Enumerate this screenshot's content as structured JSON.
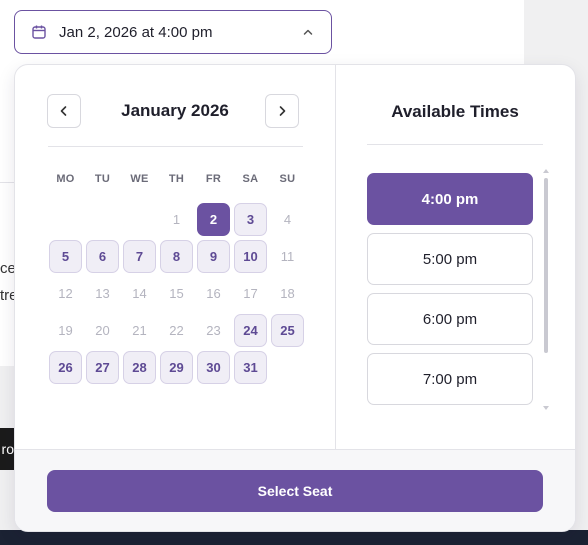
{
  "trigger": {
    "label": "Jan 2, 2026 at 4:00 pm",
    "icon": "calendar-icon",
    "chevron": "chevron-up-icon"
  },
  "background": {
    "text_line_1": "ce",
    "text_line_2": "tre",
    "dark_button_text": "ro"
  },
  "calendar": {
    "month_title": "January 2026",
    "prev_icon": "chevron-left-icon",
    "next_icon": "chevron-right-icon",
    "weekdays": [
      "MO",
      "TU",
      "WE",
      "TH",
      "FR",
      "SA",
      "SU"
    ],
    "days": [
      {
        "label": "",
        "state": "empty"
      },
      {
        "label": "",
        "state": "empty"
      },
      {
        "label": "",
        "state": "empty"
      },
      {
        "label": "1",
        "state": "disabled"
      },
      {
        "label": "2",
        "state": "selected"
      },
      {
        "label": "3",
        "state": "available"
      },
      {
        "label": "4",
        "state": "disabled"
      },
      {
        "label": "5",
        "state": "available"
      },
      {
        "label": "6",
        "state": "available"
      },
      {
        "label": "7",
        "state": "available"
      },
      {
        "label": "8",
        "state": "available"
      },
      {
        "label": "9",
        "state": "available"
      },
      {
        "label": "10",
        "state": "available"
      },
      {
        "label": "11",
        "state": "disabled"
      },
      {
        "label": "12",
        "state": "disabled"
      },
      {
        "label": "13",
        "state": "disabled"
      },
      {
        "label": "14",
        "state": "disabled"
      },
      {
        "label": "15",
        "state": "disabled"
      },
      {
        "label": "16",
        "state": "disabled"
      },
      {
        "label": "17",
        "state": "disabled"
      },
      {
        "label": "18",
        "state": "disabled"
      },
      {
        "label": "19",
        "state": "disabled"
      },
      {
        "label": "20",
        "state": "disabled"
      },
      {
        "label": "21",
        "state": "disabled"
      },
      {
        "label": "22",
        "state": "disabled"
      },
      {
        "label": "23",
        "state": "disabled"
      },
      {
        "label": "24",
        "state": "available"
      },
      {
        "label": "25",
        "state": "available"
      },
      {
        "label": "26",
        "state": "available"
      },
      {
        "label": "27",
        "state": "available"
      },
      {
        "label": "28",
        "state": "available"
      },
      {
        "label": "29",
        "state": "available"
      },
      {
        "label": "30",
        "state": "available"
      },
      {
        "label": "31",
        "state": "available"
      }
    ]
  },
  "times": {
    "title": "Available Times",
    "slots": [
      {
        "label": "4:00 pm",
        "active": true
      },
      {
        "label": "5:00 pm",
        "active": false
      },
      {
        "label": "6:00 pm",
        "active": false
      },
      {
        "label": "7:00 pm",
        "active": false
      }
    ]
  },
  "action": {
    "select_label": "Select Seat"
  },
  "colors": {
    "accent": "#6b52a1",
    "available_bg": "#f0eef6",
    "available_text": "#5e4a94",
    "disabled_text": "#b4b4bf"
  }
}
